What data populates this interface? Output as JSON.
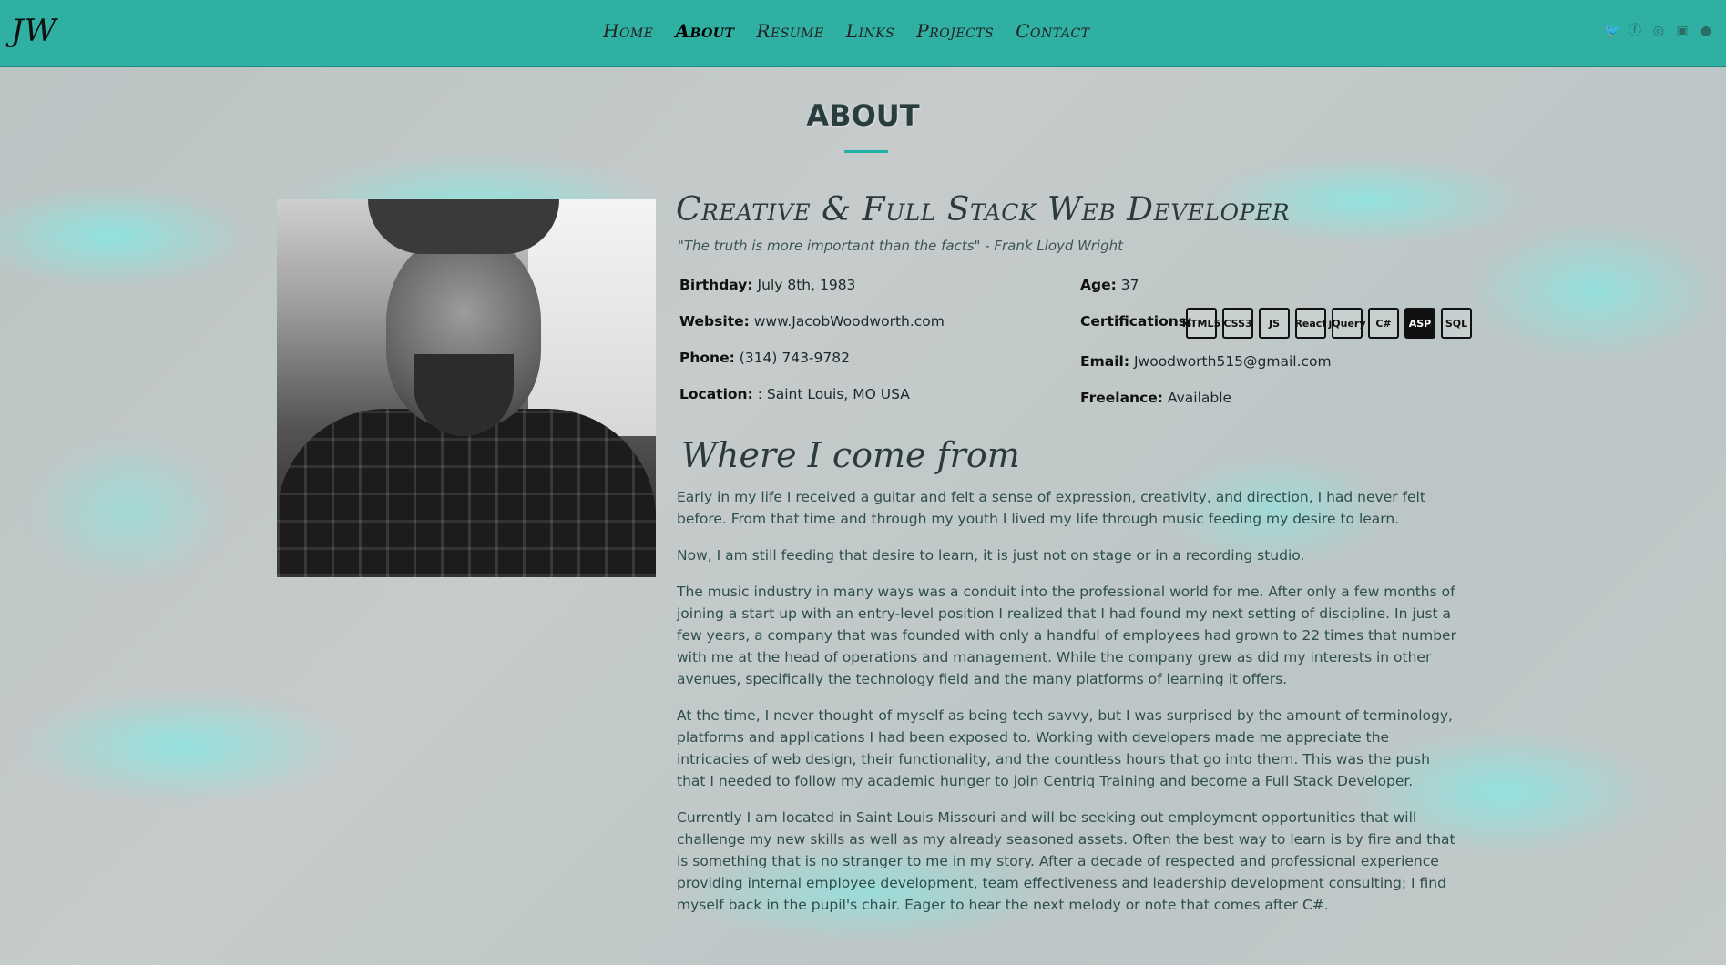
{
  "header": {
    "logo": "JW",
    "nav": [
      "Home",
      "About",
      "Resume",
      "Links",
      "Projects",
      "Contact"
    ],
    "active_nav": "About",
    "social_icons": [
      "twitter-icon",
      "facebook-icon",
      "instagram-icon",
      "linkedin-icon",
      "github-icon"
    ]
  },
  "page": {
    "title": "ABOUT"
  },
  "profile": {
    "headline": "Creative & Full Stack Web Developer",
    "quote": "\"The truth is more important than the facts\" - Frank Lloyd Wright",
    "birthday_label": "Birthday:",
    "birthday": "July 8th, 1983",
    "website_label": "Website:",
    "website": "www.JacobWoodworth.com",
    "phone_label": "Phone:",
    "phone": "(314) 743-9782",
    "location_label": "Location:",
    "location": ": Saint Louis, MO USA",
    "age_label": "Age:",
    "age": "37",
    "certifications_label": "Certifications:",
    "certifications": [
      "HTML5",
      "CSS3",
      "JS",
      "React",
      "jQuery",
      "C#",
      "ASP",
      "SQL"
    ],
    "email_label": "Email:",
    "email": "Jwoodworth515@gmail.com",
    "freelance_label": "Freelance:",
    "freelance": "Available"
  },
  "story": {
    "heading": "Where I come from",
    "paragraphs": [
      "Early in my life I received a guitar and felt a sense of expression, creativity, and direction, I had never felt before. From that time and through my youth I lived my life through music feeding my desire to learn.",
      "Now, I am still feeding that desire to learn, it is just not on stage or in a recording studio.",
      "The music industry in many ways was a conduit into the professional world for me. After only a few months of joining a start up with an entry-level position I realized that I had found my next setting of discipline. In just a few years, a company that was founded with only a handful of employees had grown to 22 times that number with me at the head of operations and management. While the company grew as did my interests in other avenues, specifically the technology field and the many platforms of learning it offers.",
      "At the time, I never thought of myself as being tech savvy, but I was surprised by the amount of terminology, platforms and applications I had been exposed to. Working with developers made me appreciate the intricacies of web design, their functionality, and the countless hours that go into them. This was the push that I needed to follow my academic hunger to join Centriq Training and become a Full Stack Developer.",
      "Currently I am located in Saint Louis Missouri and will be seeking out employment opportunities that will challenge my new skills as well as my already seasoned assets. Often the best way to learn is by fire and that is something that is no stranger to me in my story. After a decade of respected and professional experience providing internal employee development, team effectiveness and leadership development consulting; I find myself back in the pupil's chair. Eager to hear the next melody or note that comes after C#."
    ]
  },
  "colors": {
    "topbar": "#2fb0a2",
    "accent": "#1eb3a6"
  }
}
